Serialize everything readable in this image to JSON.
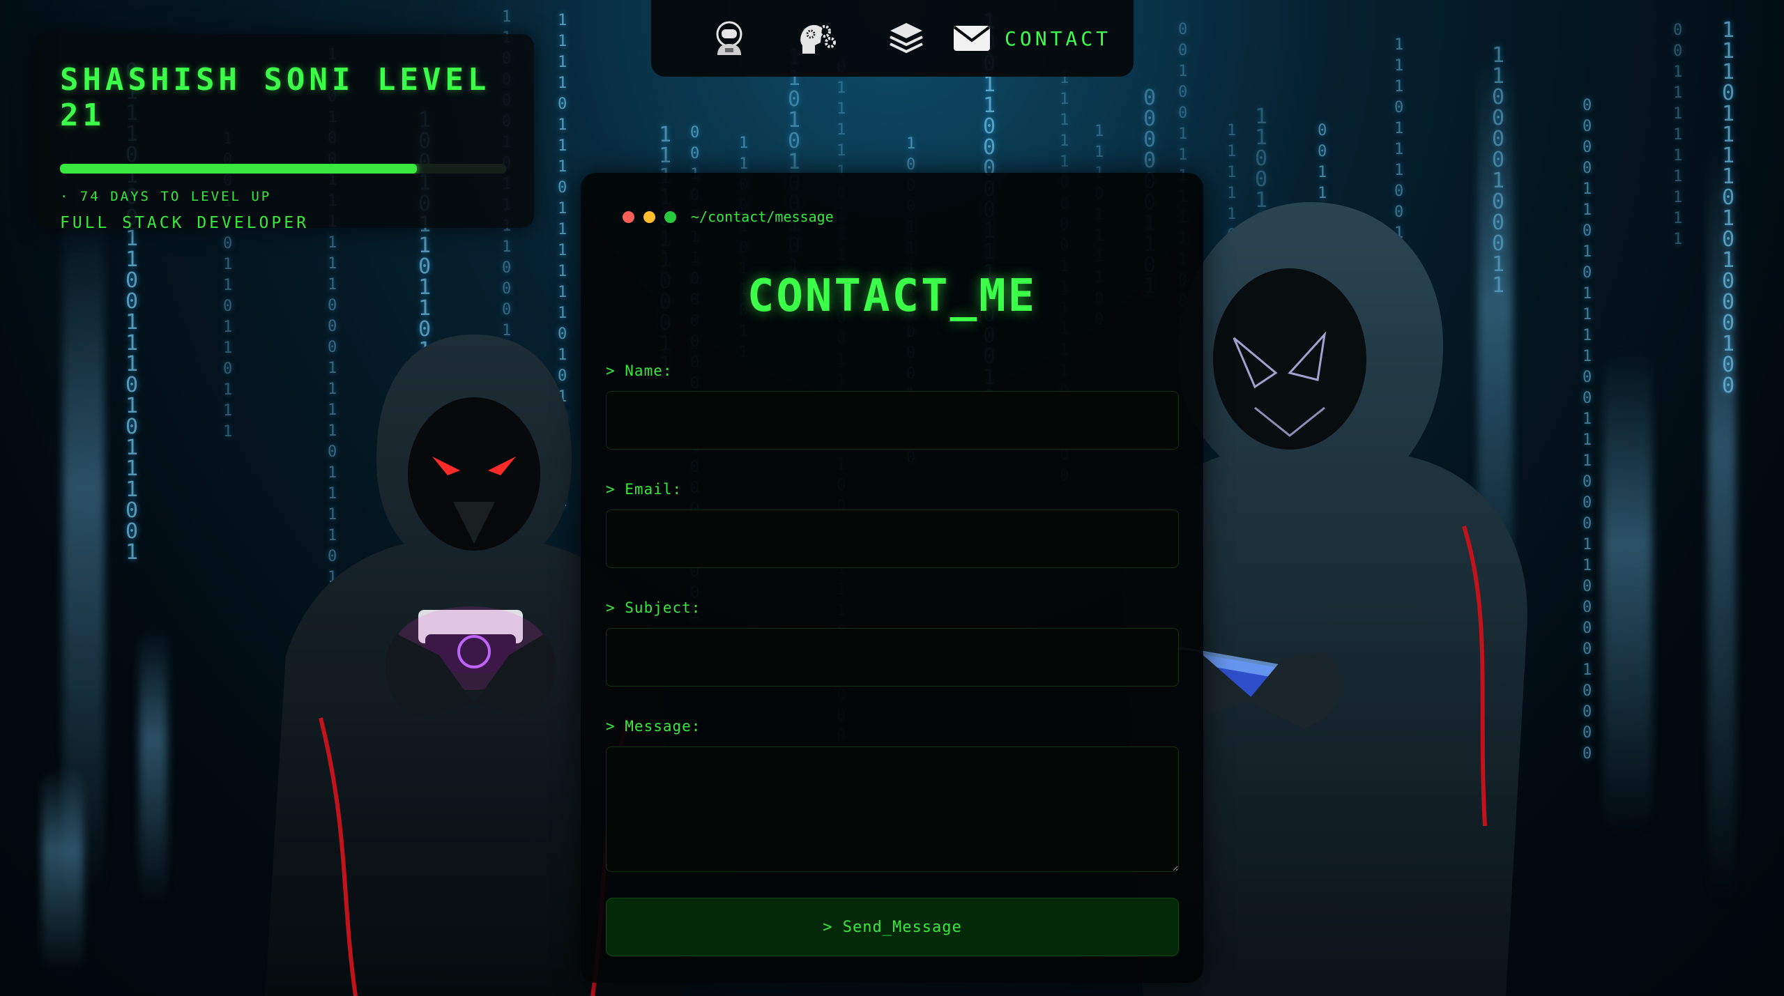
{
  "profile": {
    "title": "SHASHISH SONI LEVEL 21",
    "xp_progress_percent": 80,
    "days_to_level_up": "· 74 DAYS TO LEVEL UP",
    "role": "FULL STACK DEVELOPER"
  },
  "nav": {
    "items": [
      {
        "icon": "astronaut-icon"
      },
      {
        "icon": "brain-gears-icon"
      },
      {
        "icon": "layers-icon"
      },
      {
        "icon": "envelope-icon",
        "label": "CONTACT"
      }
    ]
  },
  "terminal": {
    "path": "~/contact/message",
    "dots": [
      "#ff5f56",
      "#ffbd2e",
      "#27c93f"
    ]
  },
  "form": {
    "title": "CONTACT_ME",
    "name_label": "> Name:",
    "email_label": "> Email:",
    "subject_label": "> Subject:",
    "message_label": "> Message:",
    "send_label": "> Send_Message"
  },
  "colors": {
    "accent": "#3cff4a",
    "panel_bg": "#020405",
    "button_bg": "#032908"
  }
}
